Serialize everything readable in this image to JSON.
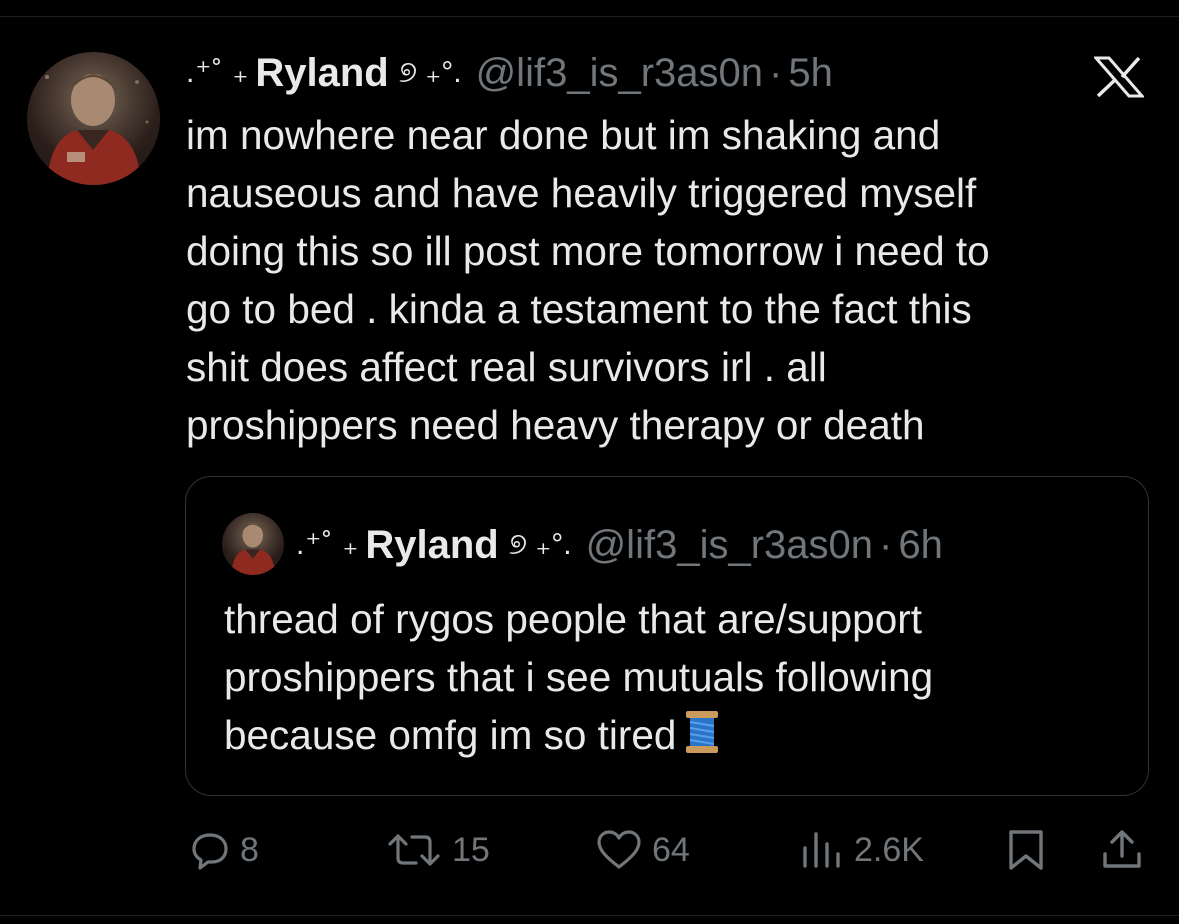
{
  "tweet": {
    "name_prefix": ".⁺˚ ₊",
    "display_name": "Ryland",
    "name_suffix": "୭ ₊°.",
    "handle": "@lif3_is_r3as0n",
    "separator": "·",
    "time": "5h",
    "text": "im nowhere near done but im shaking and\nnauseous and have heavily triggered myself\ndoing this so ill post more tomorrow i need to\ngo to bed . kinda a testament to the fact this\nshit does affect real survivors irl . all\nproshippers need heavy therapy or death",
    "platform_icon": "x-logo-icon"
  },
  "quoted": {
    "name_prefix": ".⁺˚ ₊",
    "display_name": "Ryland",
    "name_suffix": "୭ ₊°.",
    "handle": "@lif3_is_r3as0n",
    "separator": "·",
    "time": "6h",
    "text": "thread of rygos people that are/support\nproshippers that i see mutuals following\nbecause omfg im so tired",
    "emoji": "spool-of-thread-icon"
  },
  "actions": {
    "replies": "8",
    "reposts": "15",
    "likes": "64",
    "views": "2.6K"
  },
  "colors": {
    "background": "#000000",
    "text": "#e7e9ea",
    "muted": "#71767b",
    "border": "#2f3336"
  }
}
